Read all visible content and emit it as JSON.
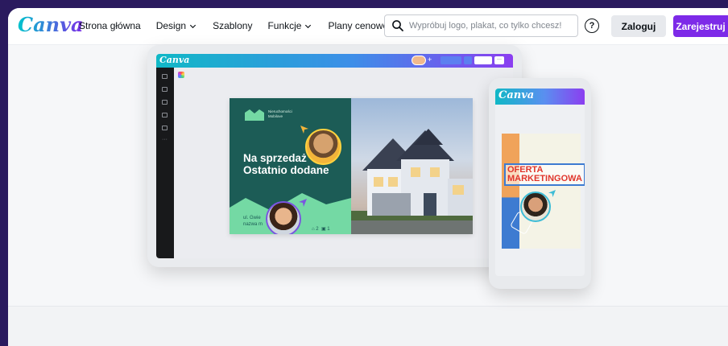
{
  "header": {
    "logo": "Canva",
    "nav": [
      {
        "label": "Strona główna",
        "dropdown": false
      },
      {
        "label": "Design",
        "dropdown": true
      },
      {
        "label": "Szablony",
        "dropdown": false
      },
      {
        "label": "Funkcje",
        "dropdown": true
      },
      {
        "label": "Plany cenowe",
        "dropdown": true
      }
    ],
    "search": {
      "placeholder": "Wypróbuj logo, plakat, co tylko chcesz!",
      "value": ""
    },
    "help_icon": "question-circle-icon",
    "login_label": "Zaloguj",
    "signup_label": "Zarejestruj"
  },
  "hero": {
    "tablet": {
      "logo": "Canva"
    },
    "poster": {
      "agency": "Nieruchomości Mobilove",
      "title_line1": "Na sprzedaż",
      "title_line2": "Ostatnio dodane",
      "address_line1": "ul. Gwie",
      "address_line2": "nazwa m"
    },
    "phone": {
      "logo": "Canva",
      "title_line1": "OFERTA",
      "title_line2": "MARKETINGOWA"
    }
  },
  "colors": {
    "brand_purple": "#7d2ae8",
    "brand_teal": "#00c4cc",
    "poster_green": "#1c5c56",
    "poster_mint": "#74d9a4",
    "phone_title_red": "#e0352b"
  }
}
